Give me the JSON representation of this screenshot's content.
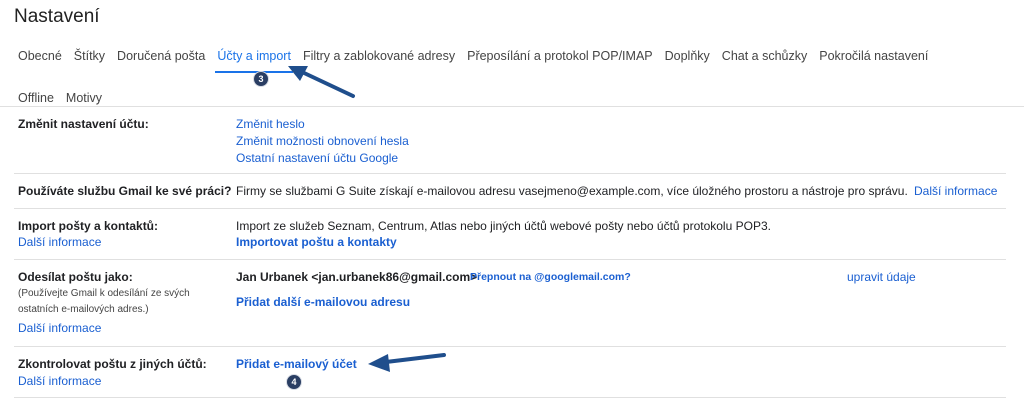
{
  "page": {
    "title": "Nastavení"
  },
  "tabs": {
    "row1": [
      "Obecné",
      "Štítky",
      "Doručená pošta",
      "Účty a import",
      "Filtry a zablokované adresy",
      "Přeposílání a protokol POP/IMAP",
      "Doplňky",
      "Chat a schůzky",
      "Pokročilá nastavení"
    ],
    "row2": [
      "Offline",
      "Motivy"
    ],
    "active": "Účty a import"
  },
  "sections": {
    "account": {
      "label": "Změnit nastavení účtu:",
      "links": [
        "Změnit heslo",
        "Změnit možnosti obnovení hesla",
        "Ostatní nastavení účtu Google"
      ]
    },
    "work": {
      "label": "Používáte službu Gmail ke své práci?",
      "text": "Firmy se službami G Suite získají e-mailovou adresu vasejmeno@example.com, více úložného prostoru a nástroje pro správu.",
      "link": "Další informace"
    },
    "import": {
      "label": "Import pošty a kontaktů:",
      "learn_more": "Další informace",
      "text": "Import ze služeb Seznam, Centrum, Atlas nebo jiných účtů webové pošty nebo účtů protokolu POP3.",
      "action": "Importovat poštu a kontakty"
    },
    "send_as": {
      "label": "Odesílat poštu jako:",
      "note_line1": "(Používejte Gmail k odesílání ze svých",
      "note_line2": "ostatních e-mailových adres.)",
      "learn_more": "Další informace",
      "sender": "Jan Urbanek <jan.urbanek86@gmail.com>",
      "switch_link": "Přepnout na @googlemail.com?",
      "edit_link": "upravit údaje",
      "add_link": "Přidat další e-mailovou adresu"
    },
    "check_mail": {
      "label": "Zkontrolovat poštu z jiných účtů:",
      "learn_more": "Další informace",
      "add_account": "Přidat e-mailový účet"
    }
  },
  "annotations": {
    "step3": "3",
    "step4": "4",
    "badge_color": "#2a3e63",
    "arrow_color": "#1f4e8c"
  }
}
